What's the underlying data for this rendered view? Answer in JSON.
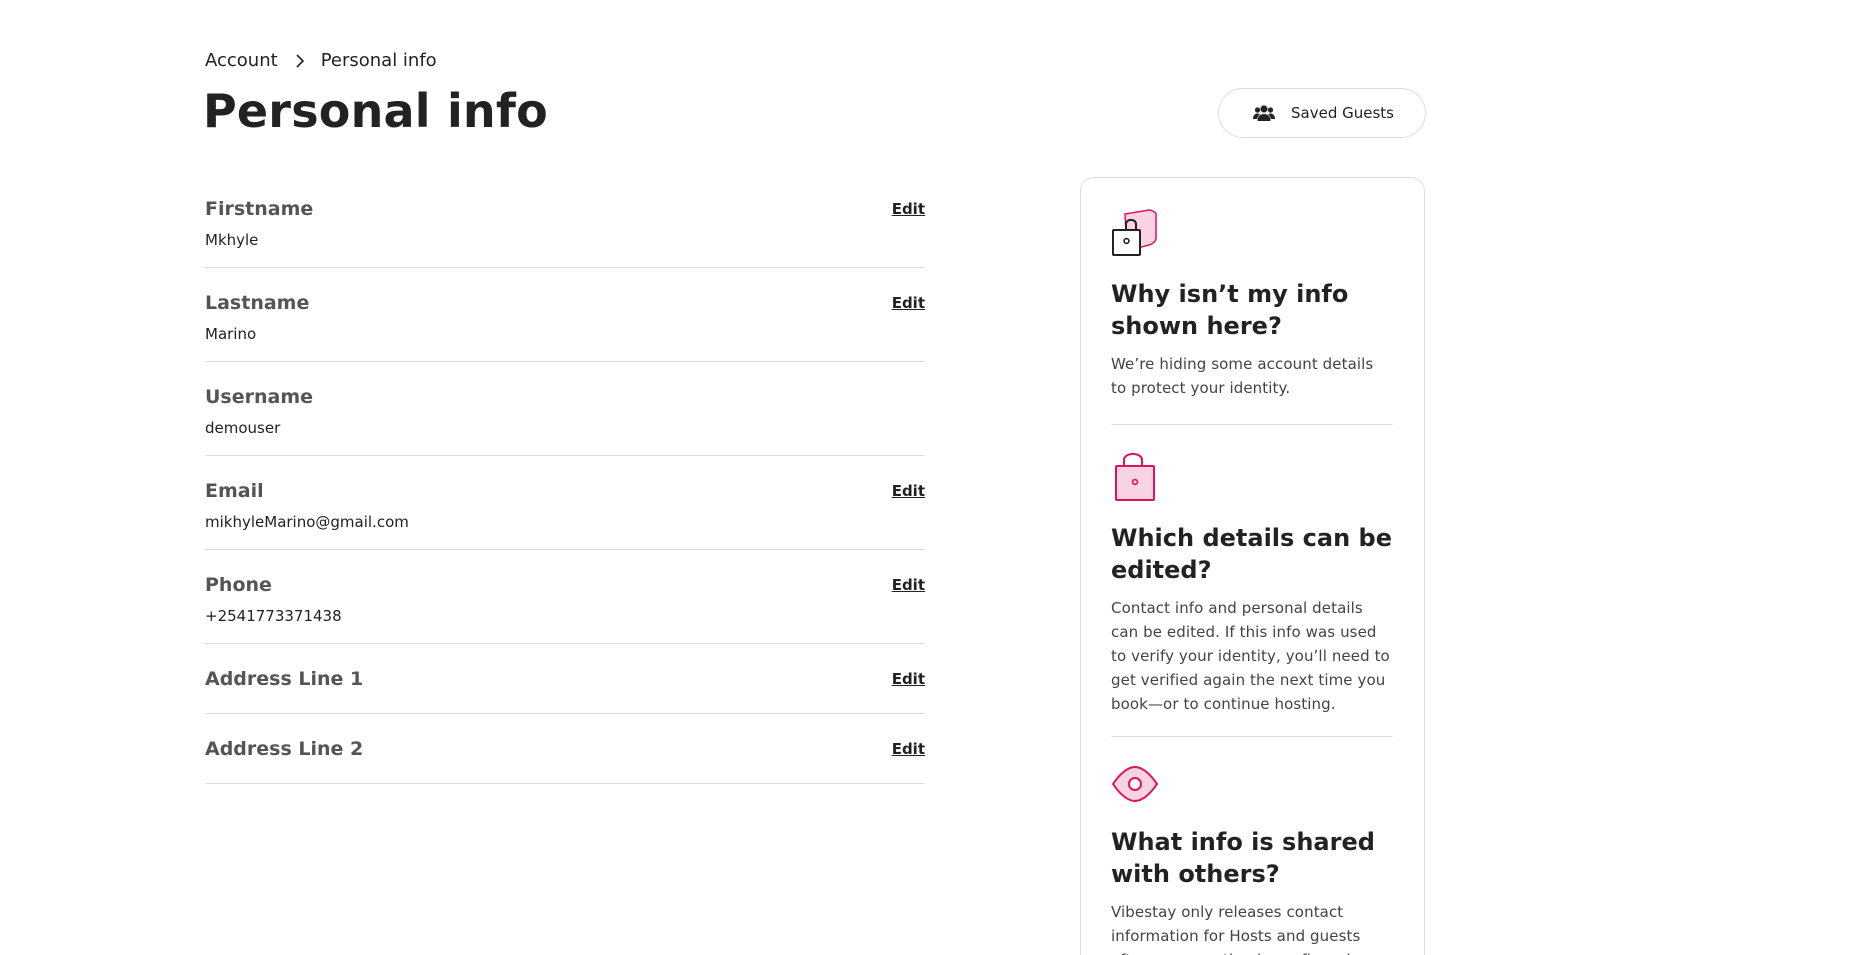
{
  "breadcrumb": {
    "parent": "Account",
    "current": "Personal info"
  },
  "page_title": "Personal info",
  "saved_guests_button": {
    "label": "Saved Guests",
    "icon": "users-icon"
  },
  "fields": [
    {
      "label": "Firstname",
      "value": "Mkhyle",
      "editable": true,
      "edit_label": "Edit"
    },
    {
      "label": "Lastname",
      "value": "Marino",
      "editable": true,
      "edit_label": "Edit"
    },
    {
      "label": "Username",
      "value": "demouser",
      "editable": false
    },
    {
      "label": "Email",
      "value": "mikhyleMarino@gmail.com",
      "editable": true,
      "edit_label": "Edit"
    },
    {
      "label": "Phone",
      "value": "+2541773371438",
      "editable": true,
      "edit_label": "Edit"
    },
    {
      "label": "Address Line 1",
      "value": "",
      "editable": true,
      "edit_label": "Edit"
    },
    {
      "label": "Address Line 2",
      "value": "",
      "editable": true,
      "edit_label": "Edit"
    }
  ],
  "info_card": {
    "sections": [
      {
        "icon": "lock-shield-icon",
        "title": "Why isn’t my info shown here?",
        "body": "We’re hiding some account details to protect your identity."
      },
      {
        "icon": "padlock-icon",
        "title": "Which details can be edited?",
        "body": "Contact info and personal details can be edited. If this info was used to verify your identity, you’ll need to get verified again the next time you book—or to continue hosting."
      },
      {
        "icon": "eye-icon",
        "title": "What info is shared with others?",
        "body": "Vibestay only releases contact information for Hosts and guests after a reservation is confirmed."
      }
    ]
  },
  "colors": {
    "accent": "#e0115f",
    "accent_light": "#f9d3e1",
    "text": "#222222",
    "muted": "#555555",
    "border": "#dddddd"
  }
}
